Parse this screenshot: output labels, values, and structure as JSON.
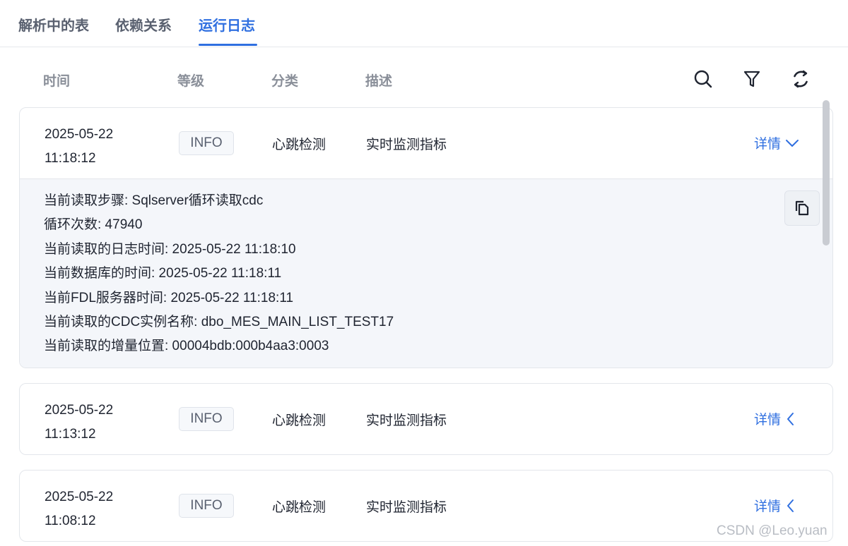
{
  "tabs": [
    {
      "label": "解析中的表"
    },
    {
      "label": "依赖关系"
    },
    {
      "label": "运行日志"
    }
  ],
  "active_tab": "运行日志",
  "columns": {
    "time": "时间",
    "level": "等级",
    "category": "分类",
    "description": "描述"
  },
  "toolbar": {
    "search_icon": "search-icon",
    "filter_icon": "filter-icon",
    "refresh_icon": "refresh-icon"
  },
  "logs": [
    {
      "date": "2025-05-22",
      "time": "11:18:12",
      "level": "INFO",
      "category": "心跳检测",
      "description": "实时监测指标",
      "detail_label": "详情",
      "expanded": true,
      "details": [
        "当前读取步骤: Sqlserver循环读取cdc",
        "循环次数: 47940",
        "当前读取的日志时间: 2025-05-22 11:18:10",
        "当前数据库的时间: 2025-05-22 11:18:11",
        "当前FDL服务器时间: 2025-05-22 11:18:11",
        "当前读取的CDC实例名称: dbo_MES_MAIN_LIST_TEST17",
        "当前读取的增量位置: 00004bdb:000b4aa3:0003"
      ]
    },
    {
      "date": "2025-05-22",
      "time": "11:13:12",
      "level": "INFO",
      "category": "心跳检测",
      "description": "实时监测指标",
      "detail_label": "详情",
      "expanded": false
    },
    {
      "date": "2025-05-22",
      "time": "11:08:12",
      "level": "INFO",
      "category": "心跳检测",
      "description": "实时监测指标",
      "detail_label": "详情",
      "expanded": false
    }
  ],
  "watermark": "CSDN @Leo.yuan",
  "colors": {
    "accent": "#2f6fe0",
    "muted": "#8a8f99",
    "detail_bg": "#f4f6fa"
  }
}
